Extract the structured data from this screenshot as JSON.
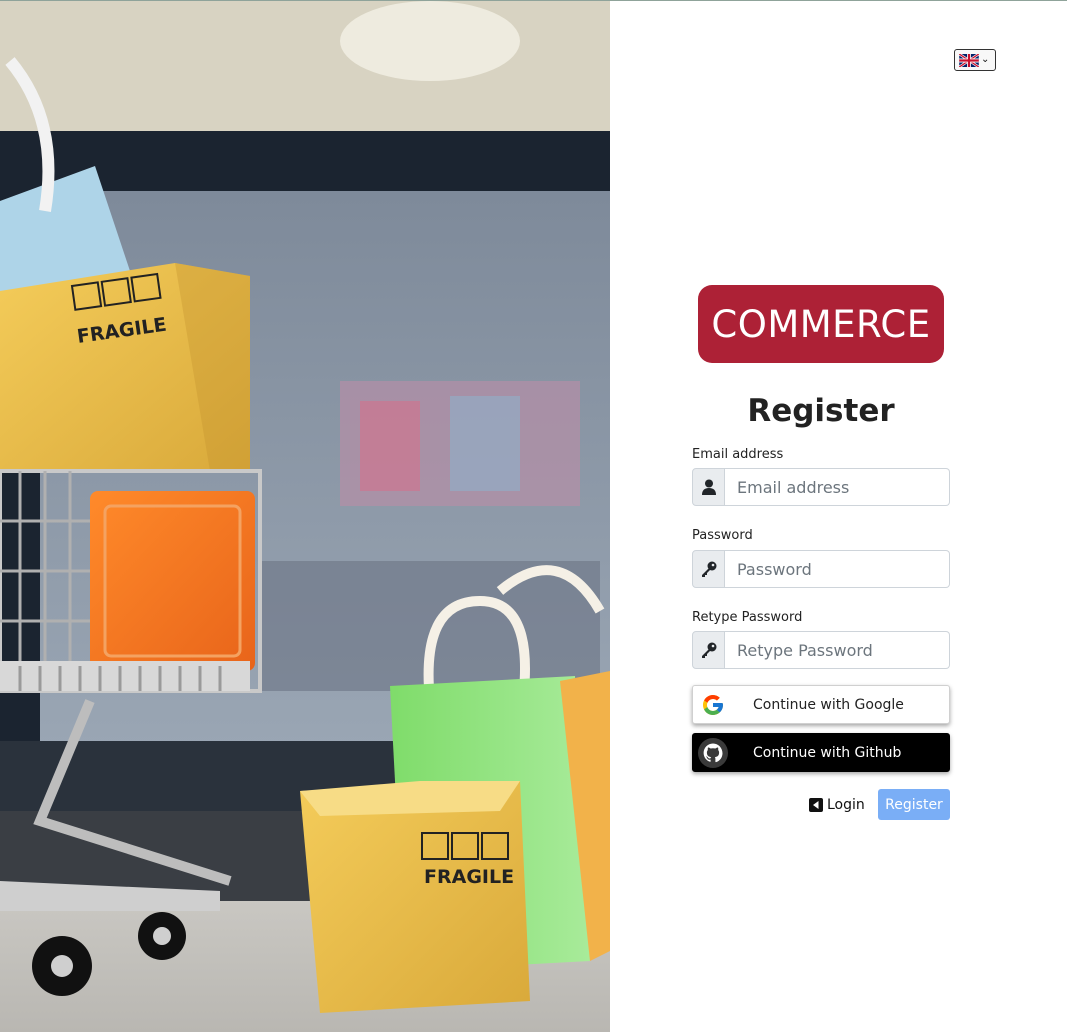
{
  "language": {
    "selected": "English (UK)"
  },
  "brand": {
    "logo_text": "COMMERCE",
    "color": "#ad2136"
  },
  "form": {
    "title": "Register",
    "email": {
      "label": "Email address",
      "placeholder": "Email address",
      "icon": "user-icon"
    },
    "password": {
      "label": "Password",
      "placeholder": "Password",
      "icon": "key-icon"
    },
    "retype_password": {
      "label": "Retype Password",
      "placeholder": "Retype Password",
      "icon": "key-icon"
    }
  },
  "social": {
    "google_label": "Continue with Google",
    "github_label": "Continue with Github"
  },
  "actions": {
    "login_label": "Login",
    "register_label": "Register",
    "register_color": "#7aaef6"
  },
  "hero": {
    "box_label_1": "FRAGILE",
    "box_label_2": "FRAGILE"
  }
}
